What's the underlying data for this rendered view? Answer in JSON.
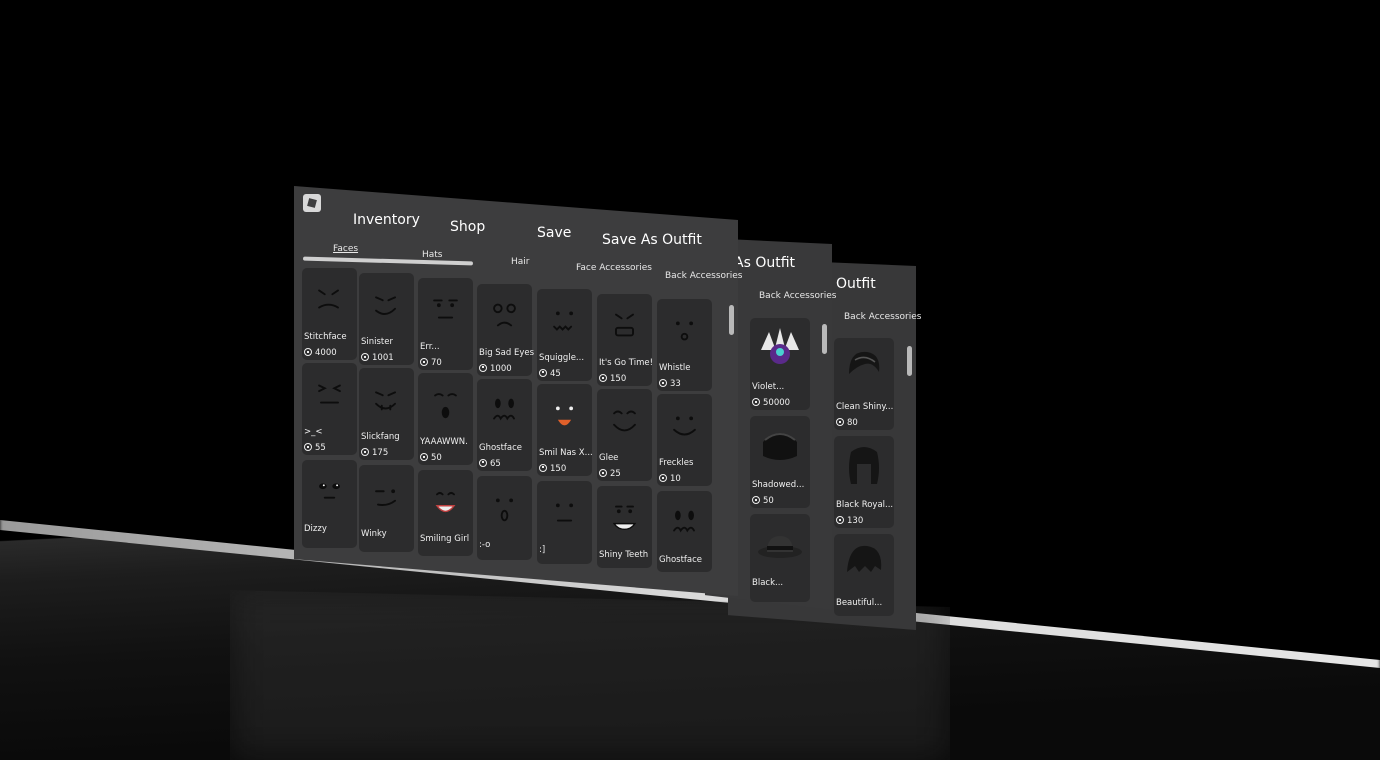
{
  "top_menu": {
    "inventory": "Inventory",
    "shop": "Shop",
    "save": "Save",
    "save_as_outfit": "Save As Outfit"
  },
  "panel2": {
    "title_partial": "As Outfit",
    "tab": "Back Accessories"
  },
  "panel3": {
    "title_partial": "Outfit",
    "tab": "Back Accessories"
  },
  "categories": {
    "faces": "Faces",
    "hats": "Hats",
    "hair": "Hair",
    "face_accessories": "Face Accessories",
    "back_accessories": "Back Accessories"
  },
  "front_items": [
    {
      "name": "Stitchface",
      "price": "4000",
      "icon": "stitch-face-icon"
    },
    {
      "name": "Sinister",
      "price": "1001",
      "icon": "sinister-face-icon"
    },
    {
      "name": "Err...",
      "price": "70",
      "icon": "err-face-icon"
    },
    {
      "name": "Big Sad Eyes",
      "price": "1000",
      "icon": "sad-eyes-face-icon"
    },
    {
      "name": "Squiggle...",
      "price": "45",
      "icon": "squiggle-face-icon"
    },
    {
      "name": "It's Go Time!",
      "price": "150",
      "icon": "go-time-face-icon"
    },
    {
      "name": "Whistle",
      "price": "33",
      "icon": "whistle-face-icon"
    },
    {
      "name": ">_<",
      "price": "55",
      "icon": "squint-face-icon"
    },
    {
      "name": "Slickfang",
      "price": "175",
      "icon": "slickfang-face-icon"
    },
    {
      "name": "YAAAWWN.",
      "price": "50",
      "icon": "yawn-face-icon"
    },
    {
      "name": "Ghostface",
      "price": "65",
      "icon": "ghost-face-icon"
    },
    {
      "name": "Smil Nas X...",
      "price": "150",
      "icon": "smile-face-icon"
    },
    {
      "name": "Glee",
      "price": "25",
      "icon": "glee-face-icon"
    },
    {
      "name": "Freckles",
      "price": "10",
      "icon": "freckles-face-icon"
    },
    {
      "name": "Dizzy",
      "price": "",
      "icon": "dizzy-face-icon"
    },
    {
      "name": "Winky",
      "price": "",
      "icon": "winky-face-icon"
    },
    {
      "name": "Smiling Girl",
      "price": "",
      "icon": "smiling-girl-face-icon"
    },
    {
      "name": ":-o",
      "price": "",
      "icon": "surprised-face-icon"
    },
    {
      "name": ":]",
      "price": "",
      "icon": "content-face-icon"
    },
    {
      "name": "Shiny Teeth",
      "price": "",
      "icon": "shiny-teeth-face-icon"
    },
    {
      "name": "Ghostface",
      "price": "",
      "icon": "ghost-face-icon"
    }
  ],
  "panel2_items": [
    {
      "name": "Violet...",
      "price": "50000",
      "icon": "violet-wings-icon"
    },
    {
      "name": "Shadowed...",
      "price": "50",
      "icon": "shadowed-hat-icon"
    },
    {
      "name": "Black...",
      "price": "",
      "icon": "black-fedora-icon"
    }
  ],
  "panel3_items": [
    {
      "name": "Clean Shiny...",
      "price": "80",
      "icon": "shiny-hair-icon"
    },
    {
      "name": "Black Royal...",
      "price": "130",
      "icon": "royal-hair-icon"
    },
    {
      "name": "Beautiful...",
      "price": "",
      "icon": "beautiful-hair-icon"
    }
  ],
  "colors": {
    "panel": "#3d3d3e",
    "card": "#2c2c2d",
    "text": "#ffffff"
  }
}
